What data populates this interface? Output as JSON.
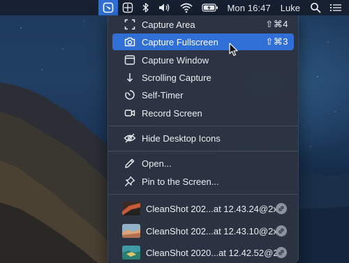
{
  "menubar": {
    "clock": "Mon 16:47",
    "user": "Luke",
    "icons": [
      "cleanshot-icon",
      "grid-icon",
      "bluetooth-icon",
      "volume-icon",
      "wifi-icon",
      "battery-icon",
      "search-icon",
      "control-list-icon"
    ]
  },
  "menu": {
    "capture_items": [
      {
        "label": "Capture Area",
        "shortcut": "⇧⌘4",
        "icon": "capture-area-icon"
      },
      {
        "label": "Capture Fullscreen",
        "shortcut": "⇧⌘3",
        "icon": "camera-icon",
        "highlighted": true
      },
      {
        "label": "Capture Window",
        "icon": "window-icon"
      },
      {
        "label": "Scrolling Capture",
        "icon": "arrow-down-icon"
      },
      {
        "label": "Self-Timer",
        "icon": "timer-icon"
      },
      {
        "label": "Record Screen",
        "icon": "video-camera-icon"
      }
    ],
    "hide_desktop_icons": "Hide Desktop Icons",
    "open": "Open...",
    "pin": "Pin to the Screen...",
    "recent": [
      {
        "label": "CleanShot 202...at 12.43.24@2x"
      },
      {
        "label": "CleanShot 202...at 12.43.10@2x"
      },
      {
        "label": "CleanShot 2020...at 12.42.52@2x"
      }
    ]
  },
  "colors": {
    "highlight": "#2f6fd6",
    "menu_bg": "#2c3442",
    "menubar_bg": "#161e2c"
  }
}
